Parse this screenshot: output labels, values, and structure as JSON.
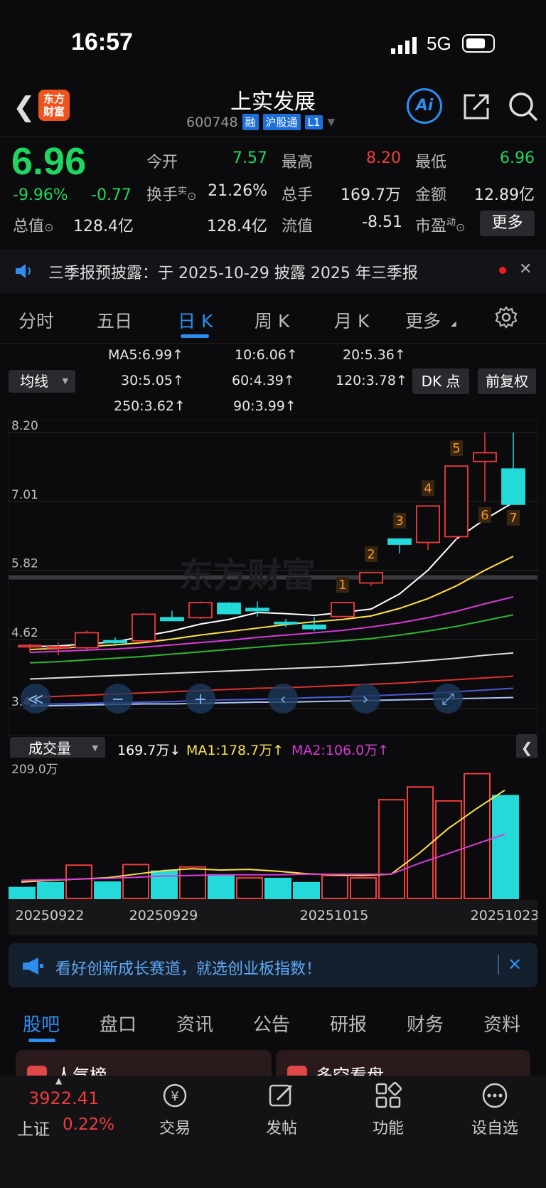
{
  "status_bar": {
    "time": "16:57",
    "network": "5G"
  },
  "header": {
    "title": "上实发展",
    "code": "600748",
    "tags": [
      "融",
      "沪股通",
      "L1"
    ],
    "ai_label": "Ai",
    "logo_text": "东方财富"
  },
  "quote": {
    "price": "6.96",
    "change_pct": "-9.96%",
    "change": "-0.77",
    "fields": [
      {
        "label": "今开",
        "value": "7.57",
        "color": "#1ed760"
      },
      {
        "label": "最高",
        "value": "8.20",
        "color": "#f03c3c"
      },
      {
        "label": "最低",
        "value": "6.96",
        "color": "#1ed760"
      },
      {
        "label": "换手",
        "sup": "实",
        "value": "21.26%",
        "color": "#e6e6e6"
      },
      {
        "label": "总手",
        "value": "169.7万",
        "color": "#e6e6e6"
      },
      {
        "label": "金额",
        "value": "12.89亿",
        "color": "#e6e6e6"
      },
      {
        "label": "总值",
        "value": "128.4亿",
        "color": "#e6e6e6"
      },
      {
        "label": "流值",
        "value": "128.4亿",
        "color": "#e6e6e6"
      },
      {
        "label": "市盈",
        "sup": "动",
        "value": "-8.51",
        "color": "#e6e6e6"
      }
    ],
    "more_label": "更多"
  },
  "notice": {
    "text": "三季报预披露：于 2025-10-29 披露 2025 年三季报"
  },
  "chart_tabs": [
    {
      "label": "分时",
      "active": false
    },
    {
      "label": "五日",
      "active": false
    },
    {
      "label": "日 K",
      "active": true
    },
    {
      "label": "周 K",
      "active": false
    },
    {
      "label": "月 K",
      "active": false
    },
    {
      "label": "更多",
      "active": false
    }
  ],
  "ma_selector": "均线",
  "dk_label": "DK 点",
  "fq_label": "前复权",
  "ma_values": [
    {
      "text": "MA5:6.99↑",
      "color": "#ffffff"
    },
    {
      "text": "10:6.06↑",
      "color": "#ffe14a"
    },
    {
      "text": "20:5.36↑",
      "color": "#d63bd6"
    },
    {
      "text": "30:5.05↑",
      "color": "#2fb52f"
    },
    {
      "text": "60:4.39↑",
      "color": "#dddddd"
    },
    {
      "text": "120:3.78↑",
      "color": "#4a5bd9"
    },
    {
      "text": "250:3.62↑",
      "color": "#a9c4f5"
    },
    {
      "text": "90:3.99↑",
      "color": "#e03030"
    }
  ],
  "chart_data": [
    {
      "type": "candlestick",
      "y_axis_labels": [
        "8.20",
        "7.01",
        "5.82",
        "4.62",
        "3.43"
      ],
      "ylim": [
        3.43,
        8.2
      ],
      "candles": [
        {
          "o": 4.5,
          "h": 4.55,
          "l": 4.4,
          "c": 4.52
        },
        {
          "o": 4.48,
          "h": 4.57,
          "l": 4.35,
          "c": 4.5
        },
        {
          "o": 4.48,
          "h": 4.78,
          "l": 4.45,
          "c": 4.74
        },
        {
          "o": 4.6,
          "h": 4.66,
          "l": 4.53,
          "c": 4.57
        },
        {
          "o": 4.6,
          "h": 5.08,
          "l": 4.58,
          "c": 5.06
        },
        {
          "o": 5.0,
          "h": 5.12,
          "l": 4.96,
          "c": 4.95
        },
        {
          "o": 5.0,
          "h": 5.28,
          "l": 4.98,
          "c": 5.26
        },
        {
          "o": 5.25,
          "h": 5.27,
          "l": 5.07,
          "c": 5.07
        },
        {
          "o": 5.16,
          "h": 5.28,
          "l": 5.02,
          "c": 5.12
        },
        {
          "o": 4.92,
          "h": 4.98,
          "l": 4.84,
          "c": 4.9
        },
        {
          "o": 4.87,
          "h": 5.01,
          "l": 4.77,
          "c": 4.81
        },
        {
          "o": 5.02,
          "h": 5.26,
          "l": 5.01,
          "c": 5.26
        },
        {
          "o": 5.6,
          "h": 5.79,
          "l": 5.55,
          "c": 5.78
        },
        {
          "o": 6.36,
          "h": 6.37,
          "l": 6.11,
          "c": 6.27
        },
        {
          "o": 6.3,
          "h": 6.93,
          "l": 6.17,
          "c": 6.93
        },
        {
          "o": 6.4,
          "h": 7.62,
          "l": 6.33,
          "c": 7.62
        },
        {
          "o": 7.7,
          "h": 8.2,
          "l": 7.01,
          "c": 7.85
        },
        {
          "o": 7.57,
          "h": 8.2,
          "l": 6.96,
          "c": 6.96
        }
      ],
      "markers": [
        {
          "index": 11,
          "label": "1"
        },
        {
          "index": 12,
          "label": "2"
        },
        {
          "index": 13,
          "label": "3"
        },
        {
          "index": 14,
          "label": "4"
        },
        {
          "index": 15,
          "label": "5"
        },
        {
          "index": 16,
          "label": "6"
        },
        {
          "index": 17,
          "label": "7"
        }
      ],
      "ma_series": [
        {
          "name": "MA5",
          "color": "#ffffff",
          "values": [
            4.5,
            4.51,
            4.55,
            4.58,
            4.68,
            4.77,
            4.89,
            4.97,
            5.09,
            5.07,
            5.04,
            5.09,
            5.15,
            5.41,
            5.82,
            6.36,
            6.7,
            6.99
          ]
        },
        {
          "name": "MA10",
          "color": "#ffe14a",
          "values": [
            4.45,
            4.47,
            4.5,
            4.53,
            4.57,
            4.63,
            4.7,
            4.76,
            4.82,
            4.88,
            4.93,
            4.97,
            5.03,
            5.16,
            5.33,
            5.55,
            5.82,
            6.06
          ]
        },
        {
          "name": "MA20",
          "color": "#d63bd6",
          "values": [
            4.4,
            4.42,
            4.44,
            4.46,
            4.49,
            4.53,
            4.57,
            4.61,
            4.66,
            4.7,
            4.74,
            4.78,
            4.84,
            4.91,
            5.0,
            5.11,
            5.24,
            5.36
          ]
        },
        {
          "name": "MA30",
          "color": "#2fb52f",
          "values": [
            4.22,
            4.24,
            4.27,
            4.3,
            4.33,
            4.37,
            4.41,
            4.45,
            4.49,
            4.53,
            4.56,
            4.6,
            4.64,
            4.7,
            4.77,
            4.85,
            4.95,
            5.05
          ]
        },
        {
          "name": "MA60",
          "color": "#dddddd",
          "values": [
            3.94,
            3.96,
            3.98,
            4.0,
            4.02,
            4.04,
            4.06,
            4.08,
            4.1,
            4.12,
            4.14,
            4.16,
            4.19,
            4.22,
            4.26,
            4.3,
            4.35,
            4.39
          ]
        },
        {
          "name": "MA90",
          "color": "#e03030",
          "values": [
            3.62,
            3.64,
            3.66,
            3.68,
            3.7,
            3.72,
            3.74,
            3.76,
            3.78,
            3.79,
            3.81,
            3.83,
            3.85,
            3.87,
            3.9,
            3.93,
            3.96,
            3.99
          ]
        },
        {
          "name": "MA120",
          "color": "#4a5bd9",
          "values": [
            3.5,
            3.51,
            3.52,
            3.53,
            3.54,
            3.55,
            3.57,
            3.58,
            3.59,
            3.6,
            3.62,
            3.63,
            3.65,
            3.67,
            3.69,
            3.72,
            3.75,
            3.78
          ]
        },
        {
          "name": "MA250",
          "color": "#a9c4f5",
          "values": [
            3.47,
            3.48,
            3.49,
            3.5,
            3.51,
            3.51,
            3.52,
            3.53,
            3.54,
            3.54,
            3.55,
            3.56,
            3.57,
            3.58,
            3.59,
            3.6,
            3.61,
            3.62
          ]
        }
      ]
    },
    {
      "type": "bar",
      "title": "成交量",
      "current": "169.7万↓",
      "ma1_label": "MA1:178.7万↑",
      "ma2_label": "MA2:106.0万↑",
      "y_max_label": "209.0万",
      "ylim": [
        0,
        209
      ],
      "volumes": [
        18,
        26,
        55,
        27,
        56,
        45,
        52,
        39,
        34,
        33,
        26,
        38,
        34,
        163,
        184,
        161,
        206,
        169.7
      ],
      "up": [
        false,
        false,
        true,
        false,
        true,
        false,
        true,
        false,
        true,
        false,
        false,
        true,
        true,
        true,
        true,
        true,
        true,
        false
      ],
      "ma1": [
        27,
        30,
        32,
        34,
        40,
        46,
        49,
        47,
        48,
        45,
        41,
        39,
        38,
        40,
        75,
        115,
        148,
        178.7
      ],
      "ma2": [
        30,
        31,
        32,
        33,
        35,
        37,
        38,
        39,
        39,
        39,
        40,
        40,
        40,
        40,
        58,
        74,
        90,
        106.0
      ],
      "x_labels": [
        {
          "index": 1,
          "text": "20250922"
        },
        {
          "index": 5,
          "text": "20250929"
        },
        {
          "index": 11,
          "text": "20251015"
        },
        {
          "index": 17,
          "text": "20251023"
        }
      ]
    }
  ],
  "watermark": "东方财富",
  "ad": {
    "text": "看好创新成长赛道，就选创业板指数！"
  },
  "bottom_tabs": [
    {
      "label": "股吧",
      "active": true
    },
    {
      "label": "盘口",
      "active": false
    },
    {
      "label": "资讯",
      "active": false
    },
    {
      "label": "公告",
      "active": false
    },
    {
      "label": "研报",
      "active": false
    },
    {
      "label": "财务",
      "active": false
    },
    {
      "label": "资料",
      "active": false
    }
  ],
  "cards": [
    "人气榜",
    "多空看盘"
  ],
  "bottom_nav": {
    "index_value": "3922.41",
    "index_name": "上证",
    "index_change": "0.22%",
    "items": [
      "交易",
      "发帖",
      "功能",
      "设自选"
    ]
  },
  "colors": {
    "up": "#f03c3c",
    "down": "#23d9d9",
    "accent": "#2d8ef0",
    "green": "#1ed760"
  }
}
